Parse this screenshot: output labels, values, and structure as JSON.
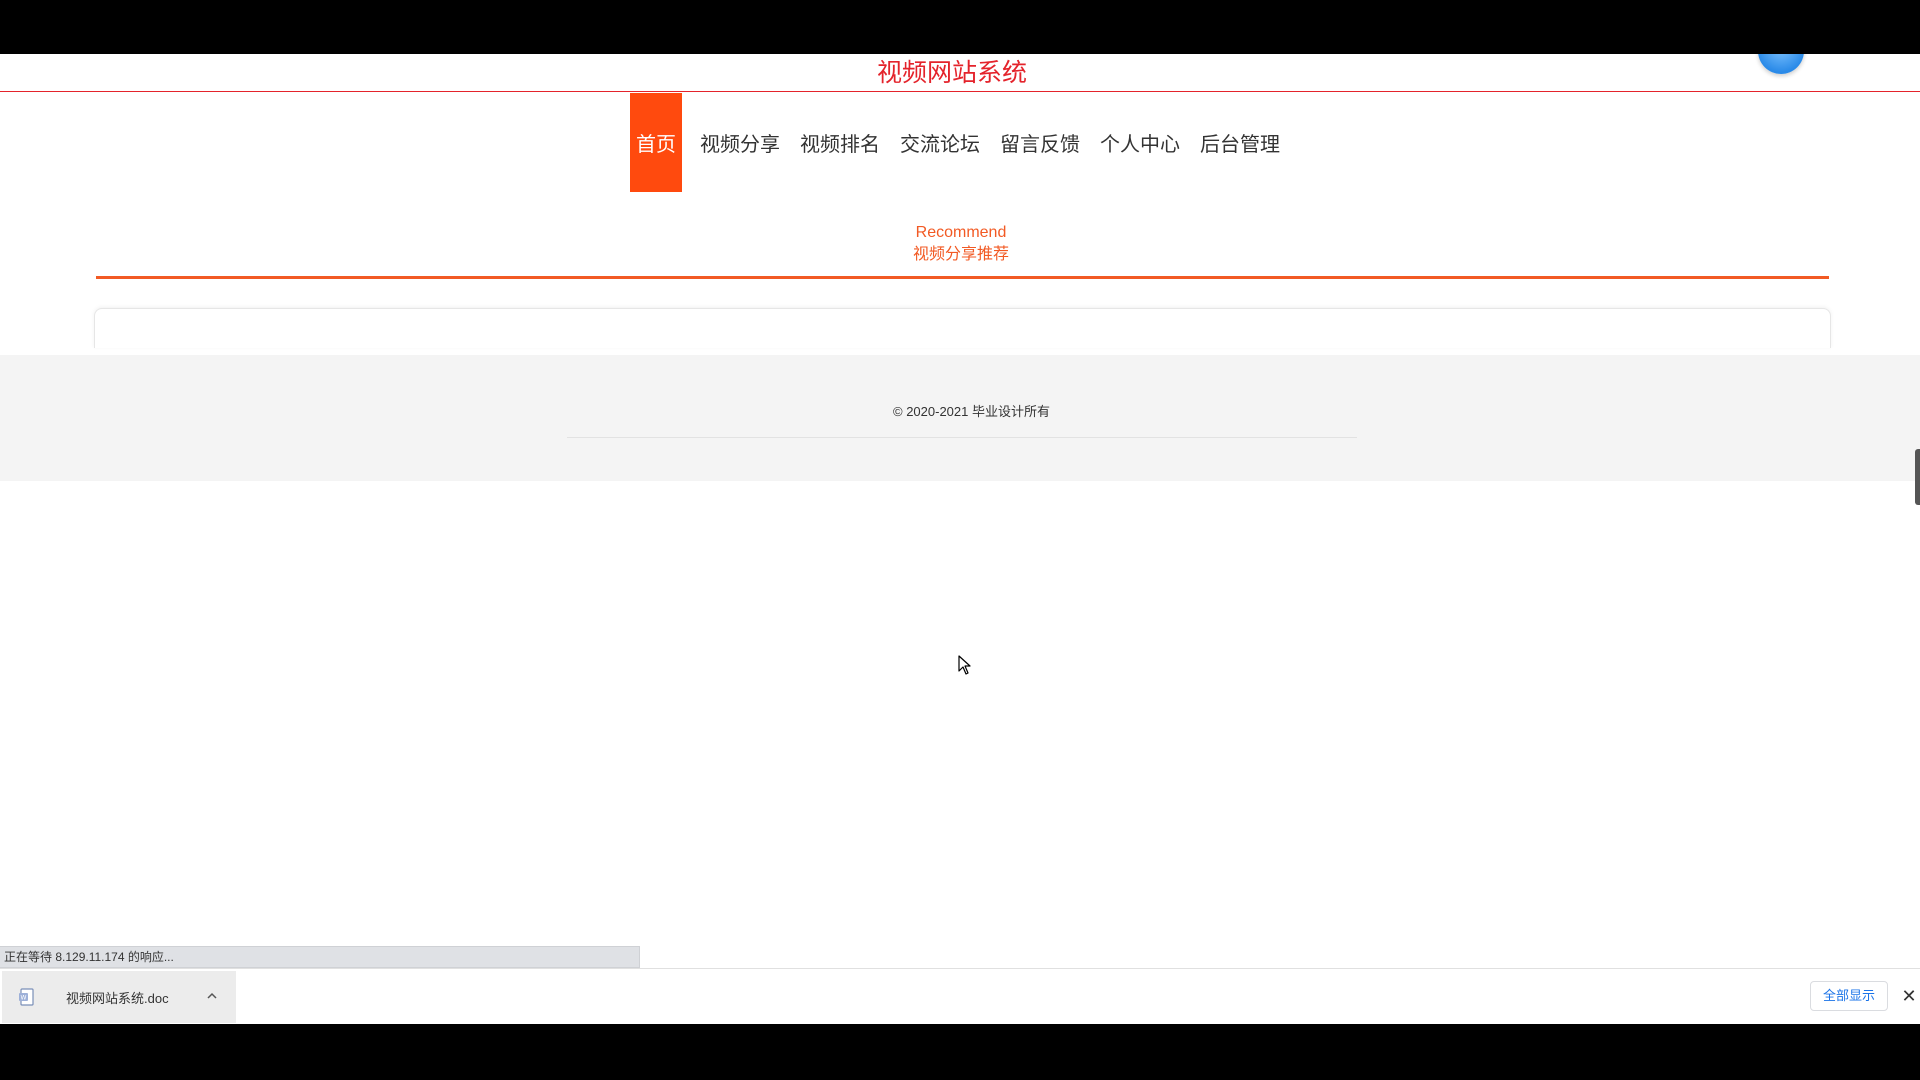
{
  "site": {
    "title": "视频网站系统"
  },
  "nav": {
    "items": [
      {
        "label": "首页",
        "active": true
      },
      {
        "label": "视频分享"
      },
      {
        "label": "视频排名"
      },
      {
        "label": "交流论坛"
      },
      {
        "label": "留言反馈"
      },
      {
        "label": "个人中心"
      },
      {
        "label": "后台管理"
      }
    ]
  },
  "recommend": {
    "title_en": "Recommend",
    "title_zh": "视频分享推荐"
  },
  "footer": {
    "copyright": "© 2020-2021 毕业设计所有"
  },
  "browser": {
    "status": "正在等待 8.129.11.174 的响应...",
    "download_file": "视频网站系统.doc",
    "show_all": "全部显示"
  },
  "colors": {
    "accent": "#ff4a0e",
    "title_red": "#e4232b",
    "section_orange": "#f25a24"
  }
}
